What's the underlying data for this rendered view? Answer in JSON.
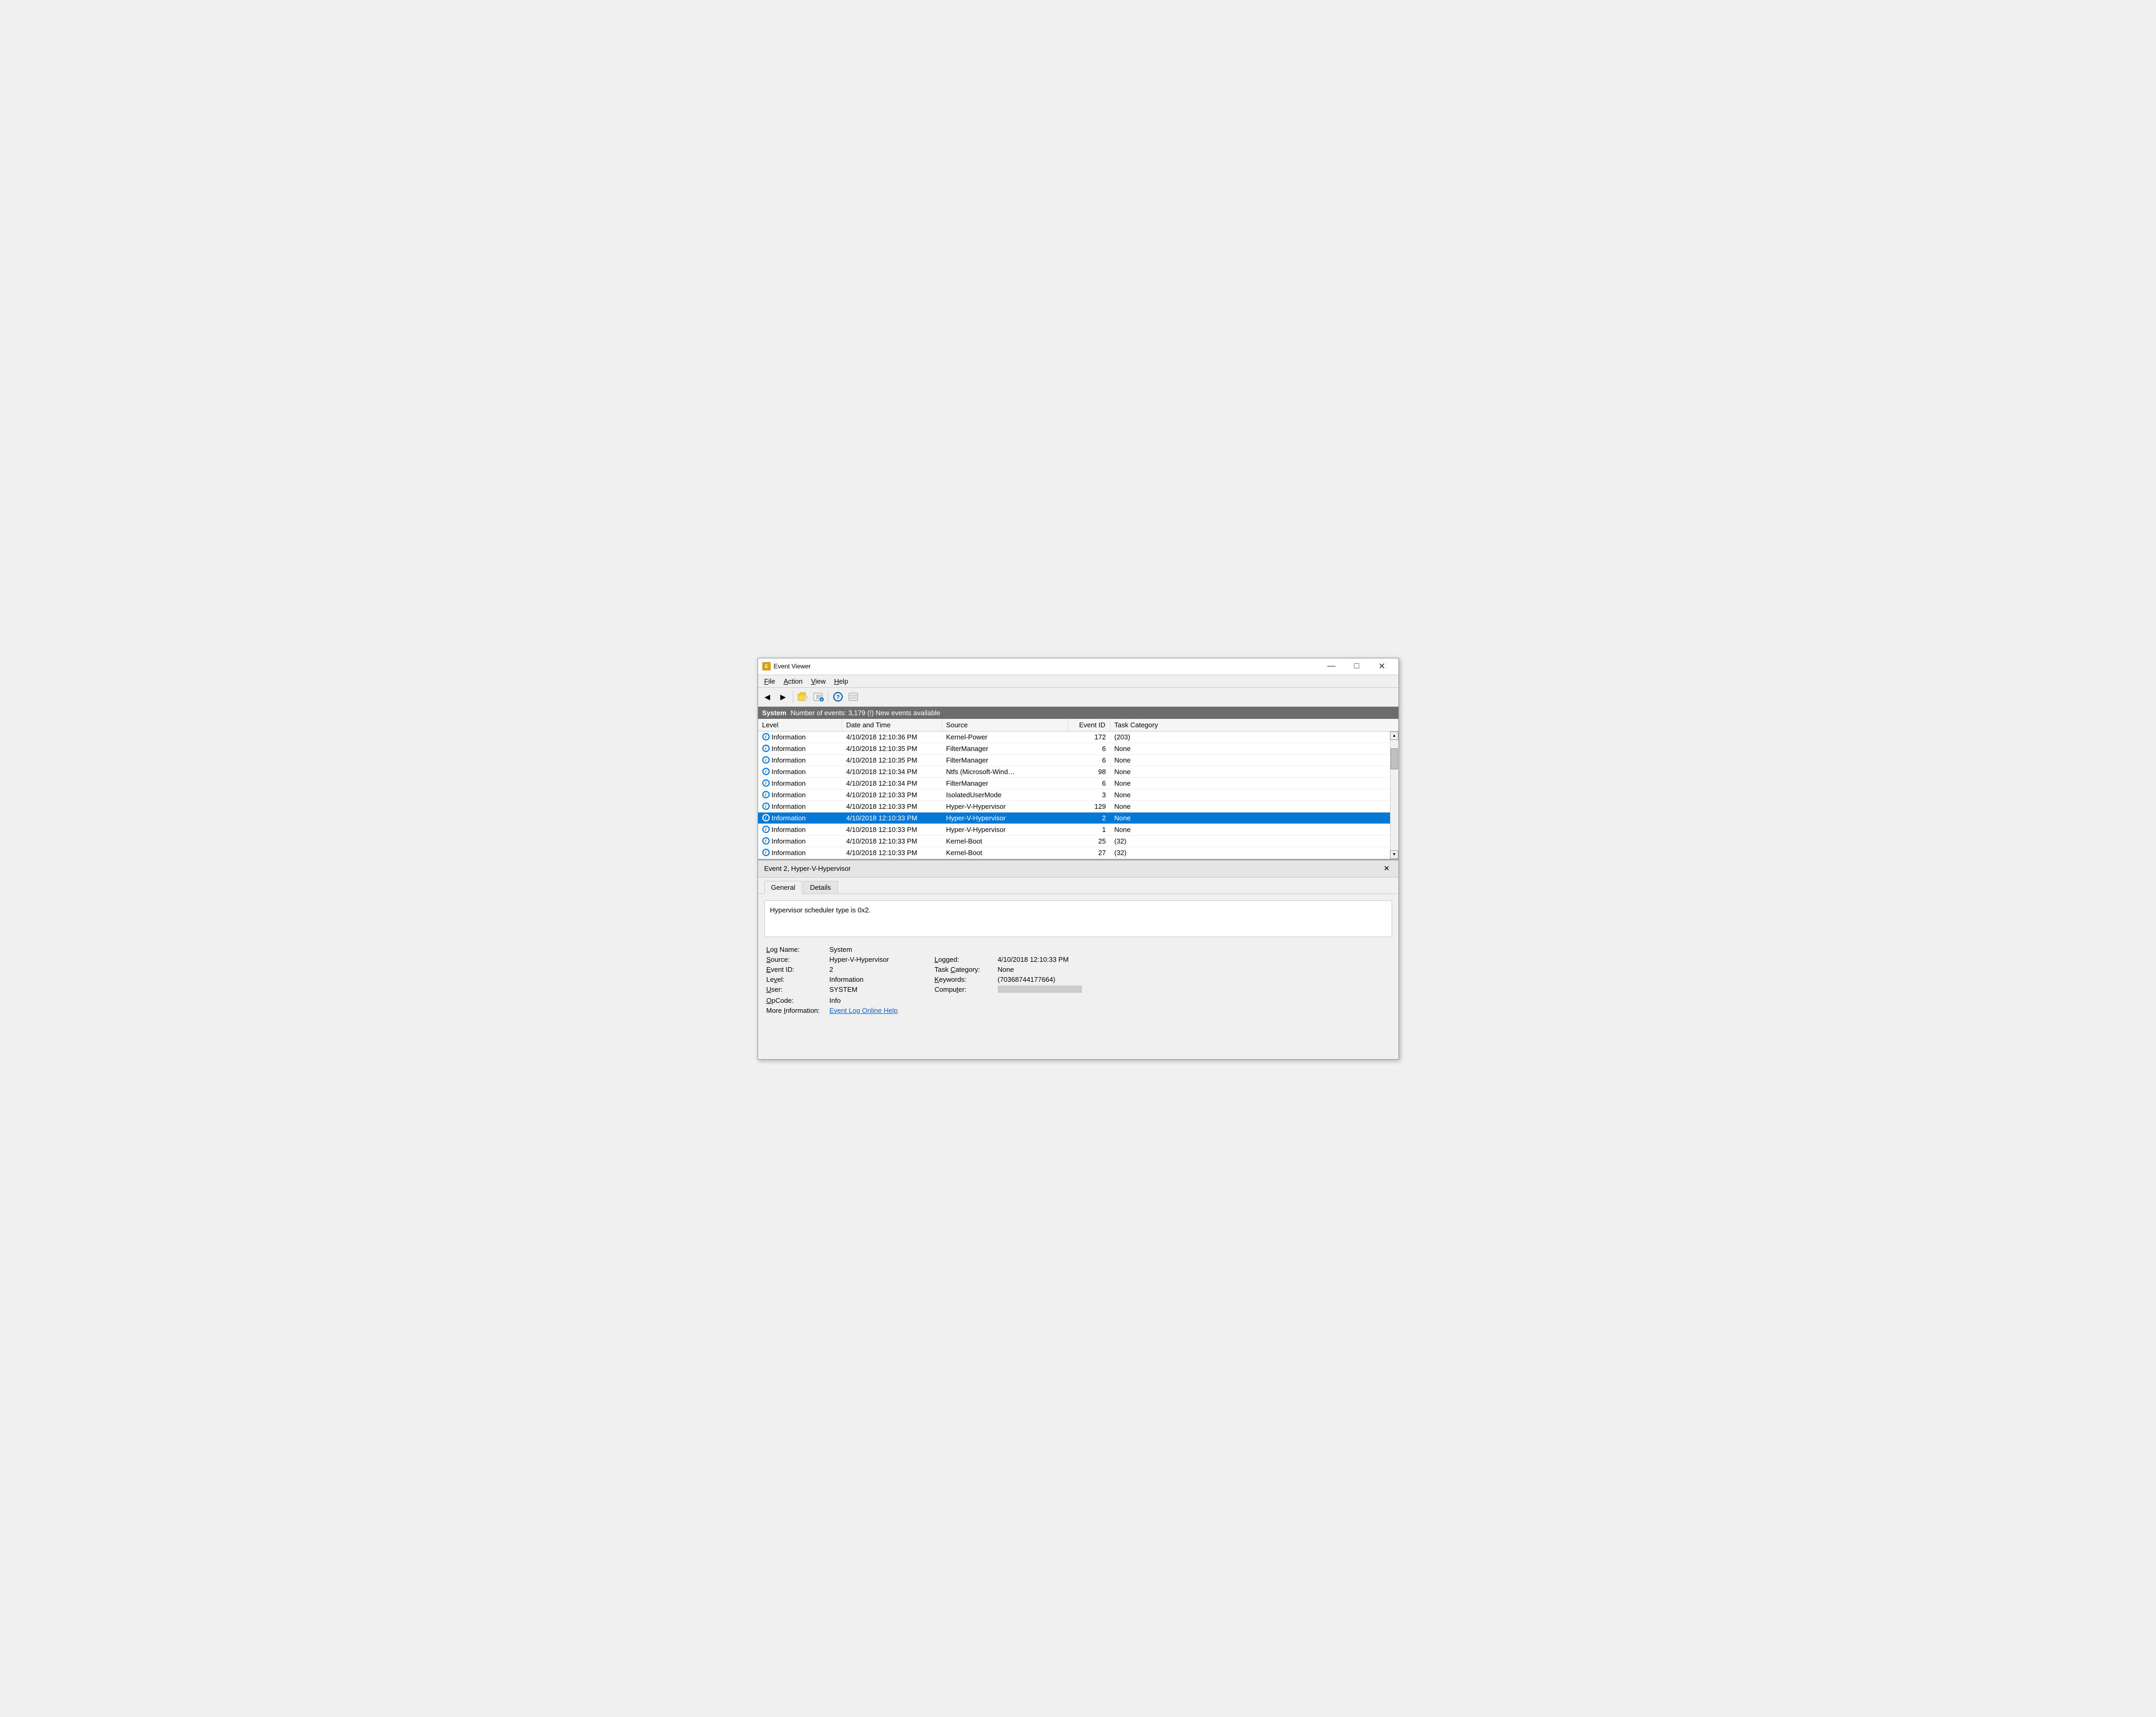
{
  "window": {
    "title": "Event Viewer",
    "icon": "ev"
  },
  "title_bar": {
    "minimize_label": "—",
    "maximize_label": "□",
    "close_label": "✕"
  },
  "menu": {
    "items": [
      {
        "label": "File",
        "underline_char": "F"
      },
      {
        "label": "Action",
        "underline_char": "A"
      },
      {
        "label": "View",
        "underline_char": "V"
      },
      {
        "label": "Help",
        "underline_char": "H"
      }
    ]
  },
  "toolbar": {
    "buttons": [
      "◀",
      "▶",
      "📁",
      "⊞",
      "?",
      "⊟"
    ]
  },
  "status": {
    "log_name": "System",
    "message": "Number of events: 3,179 (!) New events available"
  },
  "columns": {
    "level": "Level",
    "datetime": "Date and Time",
    "source": "Source",
    "eventid": "Event ID",
    "category": "Task Category"
  },
  "events": [
    {
      "level": "Information",
      "datetime": "4/10/2018 12:10:36 PM",
      "source": "Kernel-Power",
      "eventid": "172",
      "category": "(203)",
      "selected": false
    },
    {
      "level": "Information",
      "datetime": "4/10/2018 12:10:35 PM",
      "source": "FilterManager",
      "eventid": "6",
      "category": "None",
      "selected": false
    },
    {
      "level": "Information",
      "datetime": "4/10/2018 12:10:35 PM",
      "source": "FilterManager",
      "eventid": "6",
      "category": "None",
      "selected": false
    },
    {
      "level": "Information",
      "datetime": "4/10/2018 12:10:34 PM",
      "source": "Ntfs (Microsoft-Wind…",
      "eventid": "98",
      "category": "None",
      "selected": false
    },
    {
      "level": "Information",
      "datetime": "4/10/2018 12:10:34 PM",
      "source": "FilterManager",
      "eventid": "6",
      "category": "None",
      "selected": false
    },
    {
      "level": "Information",
      "datetime": "4/10/2018 12:10:33 PM",
      "source": "IsolatedUserMode",
      "eventid": "3",
      "category": "None",
      "selected": false
    },
    {
      "level": "Information",
      "datetime": "4/10/2018 12:10:33 PM",
      "source": "Hyper-V-Hypervisor",
      "eventid": "129",
      "category": "None",
      "selected": false
    },
    {
      "level": "Information",
      "datetime": "4/10/2018 12:10:33 PM",
      "source": "Hyper-V-Hypervisor",
      "eventid": "2",
      "category": "None",
      "selected": true
    },
    {
      "level": "Information",
      "datetime": "4/10/2018 12:10:33 PM",
      "source": "Hyper-V-Hypervisor",
      "eventid": "1",
      "category": "None",
      "selected": false
    },
    {
      "level": "Information",
      "datetime": "4/10/2018 12:10:33 PM",
      "source": "Kernel-Boot",
      "eventid": "25",
      "category": "(32)",
      "selected": false
    },
    {
      "level": "Information",
      "datetime": "4/10/2018 12:10:33 PM",
      "source": "Kernel-Boot",
      "eventid": "27",
      "category": "(32)",
      "selected": false
    }
  ],
  "detail_pane": {
    "title": "Event 2, Hyper-V-Hypervisor",
    "tabs": [
      "General",
      "Details"
    ],
    "active_tab": "General",
    "description": "Hypervisor scheduler type is 0x2.",
    "fields": {
      "log_name_label": "Log Name:",
      "log_name_value": "System",
      "source_label": "Source:",
      "source_value": "Hyper-V-Hypervisor",
      "logged_label": "Logged:",
      "logged_value": "4/10/2018 12:10:33 PM",
      "event_id_label": "Event ID:",
      "event_id_value": "2",
      "task_category_label": "Task Category:",
      "task_category_value": "None",
      "level_label": "Level:",
      "level_value": "Information",
      "keywords_label": "Keywords:",
      "keywords_value": "(70368744177664)",
      "user_label": "User:",
      "user_value": "SYSTEM",
      "computer_label": "Computer:",
      "computer_value": "[redacted]",
      "opcode_label": "OpCode:",
      "opcode_value": "Info",
      "more_info_label": "More Information:",
      "more_info_link": "Event Log Online Help"
    },
    "close_label": "✕"
  },
  "colors": {
    "selected_bg": "#0078d7",
    "header_bg": "#6d6d6d",
    "link_color": "#0066cc"
  }
}
